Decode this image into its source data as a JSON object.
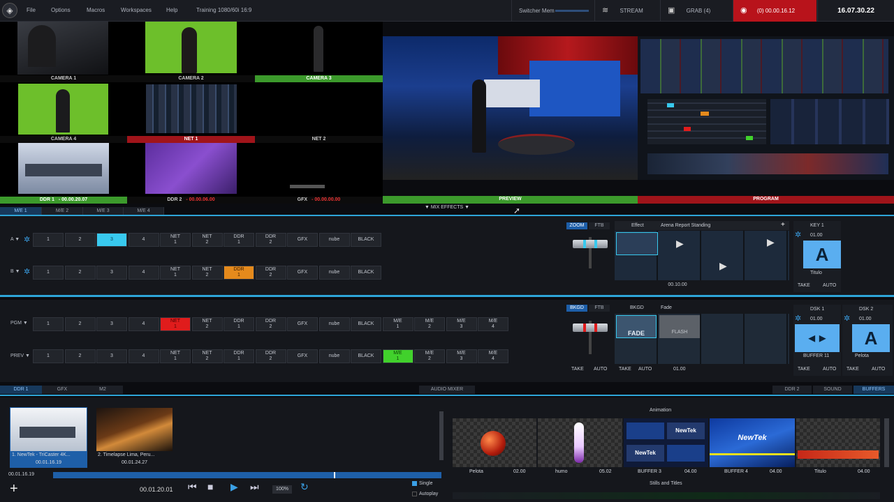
{
  "menubar": {
    "logo": "◈",
    "items": [
      "File",
      "Options",
      "Macros",
      "Workspaces",
      "Help"
    ],
    "session": "Training 1080/60i 16:9",
    "switcher_mem": "Switcher Mem",
    "stream": "STREAM",
    "grab": "GRAB (4)",
    "record": "(0) 00.00.16.12",
    "clock": "16.07.30.22"
  },
  "multiview": {
    "cells": [
      {
        "label": "CAMERA 1",
        "style": "dark"
      },
      {
        "label": "CAMERA 2",
        "style": "dark"
      },
      {
        "label": "CAMERA 3",
        "style": "green"
      },
      {
        "label": "CAMERA 4",
        "style": "dark"
      },
      {
        "label": "NET 1",
        "style": "red"
      },
      {
        "label": "NET 2",
        "style": "dark"
      },
      {
        "label": "DDR 1",
        "time": "- 00.00.20.07",
        "style": "green"
      },
      {
        "label": "DDR 2",
        "time": "- 00.00.06.00",
        "style": "dark"
      },
      {
        "label": "GFX",
        "time": "- 00.00.00.00",
        "style": "dark"
      }
    ],
    "preview_label": "PREVIEW",
    "program_label": "PROGRAM",
    "mix_effects": "▼ MIX EFFECTS ▼"
  },
  "me_tabs": [
    "M/E 1",
    "M/E 2",
    "M/E 3",
    "M/E 4"
  ],
  "me1": {
    "row_a": "A ▼",
    "row_b": "B ▼",
    "a_buttons": [
      "1",
      "2",
      "3",
      "4",
      "NET\n1",
      "NET\n2",
      "DDR\n1",
      "DDR\n2",
      "GFX",
      "nube",
      "BLACK"
    ],
    "b_buttons": [
      "1",
      "2",
      "3",
      "4",
      "NET\n1",
      "NET\n2",
      "DDR\n1",
      "DDR\n2",
      "GFX",
      "nube",
      "BLACK"
    ],
    "zoom": "ZOOM",
    "ftb": "FTB",
    "effect": "Effect",
    "effect_name": "Arena Report Standing",
    "effect_time": "00.10.00",
    "key_label": "KEY 1",
    "key_time": "01.00",
    "key_name": "Titulo",
    "take": "TAKE",
    "auto": "AUTO"
  },
  "main": {
    "pgm": "PGM ▼",
    "prev": "PREV ▼",
    "pgm_buttons": [
      "1",
      "2",
      "3",
      "4",
      "NET\n1",
      "NET\n2",
      "DDR\n1",
      "DDR\n2",
      "GFX",
      "nube",
      "BLACK",
      "M/E\n1",
      "M/E\n2",
      "M/E\n3",
      "M/E\n4"
    ],
    "prev_buttons": [
      "1",
      "2",
      "3",
      "4",
      "NET\n1",
      "NET\n2",
      "DDR\n1",
      "DDR\n2",
      "GFX",
      "nube",
      "BLACK",
      "M/E\n1",
      "M/E\n2",
      "M/E\n3",
      "M/E\n4"
    ],
    "bkgd": "BKGD",
    "ftb": "FTB",
    "bkgd_label": "BKGD",
    "fade_label": "Fade",
    "fade_tile": "FADE",
    "flash_tile": "FLASH",
    "trans_time": "01.00",
    "dsk1": "DSK 1",
    "dsk2": "DSK 2",
    "dsk_time": "01.00",
    "dsk1_name": "BUFFER 11",
    "dsk2_name": "Pelota",
    "take": "TAKE",
    "auto": "AUTO"
  },
  "bottom_tabs": {
    "left": [
      "DDR 1",
      "GFX",
      "M2"
    ],
    "audio": "AUDIO MIXER",
    "right": [
      "DDR 2",
      "SOUND",
      "BUFFERS"
    ]
  },
  "ddr": {
    "clips": [
      {
        "title": "1. NewTek - TriCaster 4K...",
        "time": "00.01.16.19"
      },
      {
        "title": "2. Timelapse Lima, Peru...",
        "time": "00.01.24.27"
      }
    ],
    "position": "00.01.16.19",
    "timecode": "00.01.20.01",
    "speed": "100%",
    "single": "Single",
    "autoplay": "Autoplay",
    "add": "+"
  },
  "buffers": {
    "section": "Animation",
    "items": [
      {
        "name": "Pelota",
        "time": "02.00"
      },
      {
        "name": "humo",
        "time": "05.02"
      },
      {
        "name": "BUFFER 3",
        "time": "04.00"
      },
      {
        "name": "BUFFER 4",
        "time": "04.00"
      },
      {
        "name": "Titulo",
        "time": "04.00"
      }
    ],
    "stills": "Stills and Titles",
    "newtek": "NewTek"
  },
  "colors": {
    "accent": "#2ea5d8",
    "tally_red": "#e01c1c",
    "tally_green": "#41d12c",
    "preview_cyan": "#38c9ee",
    "orange": "#e58a1c"
  }
}
